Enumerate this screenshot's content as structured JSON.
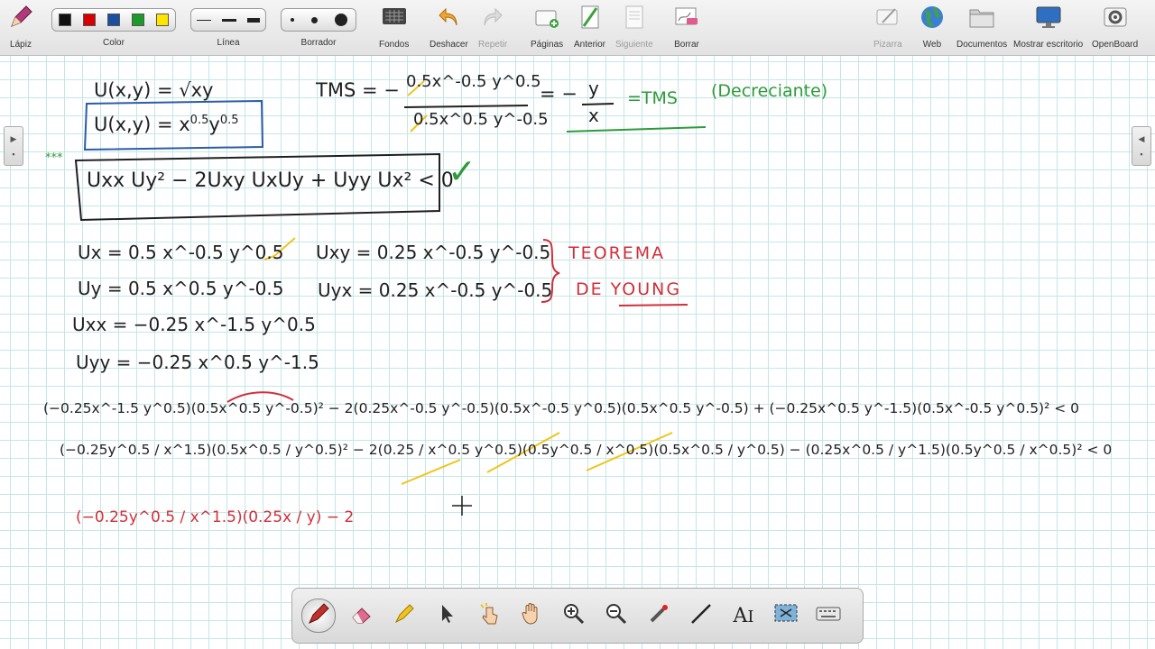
{
  "toolbar": {
    "pen_label": "Lápiz",
    "color_label": "Color",
    "colors": [
      "#111111",
      "#d60000",
      "#1a4fa0",
      "#1c9a2a",
      "#ffe600"
    ],
    "line_label": "Línea",
    "eraser_label": "Borrador",
    "backgrounds_label": "Fondos",
    "undo_label": "Deshacer",
    "redo_label": "Repetir",
    "pages_label": "Páginas",
    "prev_label": "Anterior",
    "next_label": "Siguiente",
    "clear_label": "Borrar",
    "board_label": "Pizarra",
    "web_label": "Web",
    "documents_label": "Documentos",
    "desktop_label": "Mostrar escritorio",
    "openboard_label": "OpenBoard"
  },
  "board": {
    "line1_u": "U(x,y) = √xy",
    "line2_u": "U(x,y) = x",
    "line2_exp1": "0.5",
    "line2_y": "y",
    "line2_exp2": "0.5",
    "tms_prefix": "TMS = −",
    "tms_num": "0.5x^-0.5 y^0.5",
    "tms_den": "0.5x^0.5 y^-0.5",
    "tms_equals": "= −",
    "tms_y": "y",
    "tms_x": "x",
    "tms_result": "=TMS",
    "tms_note": "(Decreciante)",
    "stars": "***",
    "condition": "Uxx Uy² − 2Uxy UxUy + Uyy Ux² < 0",
    "check": "✓",
    "ux": "Ux = 0.5 x^-0.5 y^0.5",
    "uy": "Uy = 0.5 x^0.5 y^-0.5",
    "uxx": "Uxx = −0.25 x^-1.5 y^0.5",
    "uyy": "Uyy = −0.25 x^0.5 y^-1.5",
    "uxy": "Uxy = 0.25 x^-0.5 y^-0.5",
    "uyx": "Uyx = 0.25 x^-0.5 y^-0.5",
    "theorem_line1": "TEOREMA",
    "theorem_line2": "DE YOUNG",
    "long_eq1": "(−0.25x^-1.5 y^0.5)(0.5x^0.5 y^-0.5)² − 2(0.25x^-0.5 y^-0.5)(0.5x^-0.5 y^0.5)(0.5x^0.5 y^-0.5) + (−0.25x^0.5 y^-1.5)(0.5x^-0.5 y^0.5)² < 0",
    "long_eq2": "(−0.25y^0.5 / x^1.5)(0.5x^0.5 / y^0.5)² − 2(0.25 / x^0.5 y^0.5)(0.5y^0.5 / x^0.5)(0.5x^0.5 / y^0.5) − (0.25x^0.5 / y^1.5)(0.5y^0.5 / x^0.5)² < 0",
    "red_eq": "(−0.25y^0.5 / x^1.5)(0.25x / y) − 2"
  },
  "palette": {
    "tools": [
      "pen-icon",
      "eraser-icon",
      "highlighter-icon",
      "pointer-icon",
      "interact-icon",
      "hand-icon",
      "zoom-in-icon",
      "zoom-out-icon",
      "laser-icon",
      "line-icon",
      "text-icon",
      "capture-icon",
      "keyboard-icon"
    ]
  },
  "colors": {
    "ink_black": "#1f1f1f",
    "ink_green": "#2e9a3a",
    "ink_red": "#d0303a",
    "ink_blue": "#2b5ca8",
    "ink_yellow": "#f0c419",
    "grid": "#c5e6e6"
  }
}
